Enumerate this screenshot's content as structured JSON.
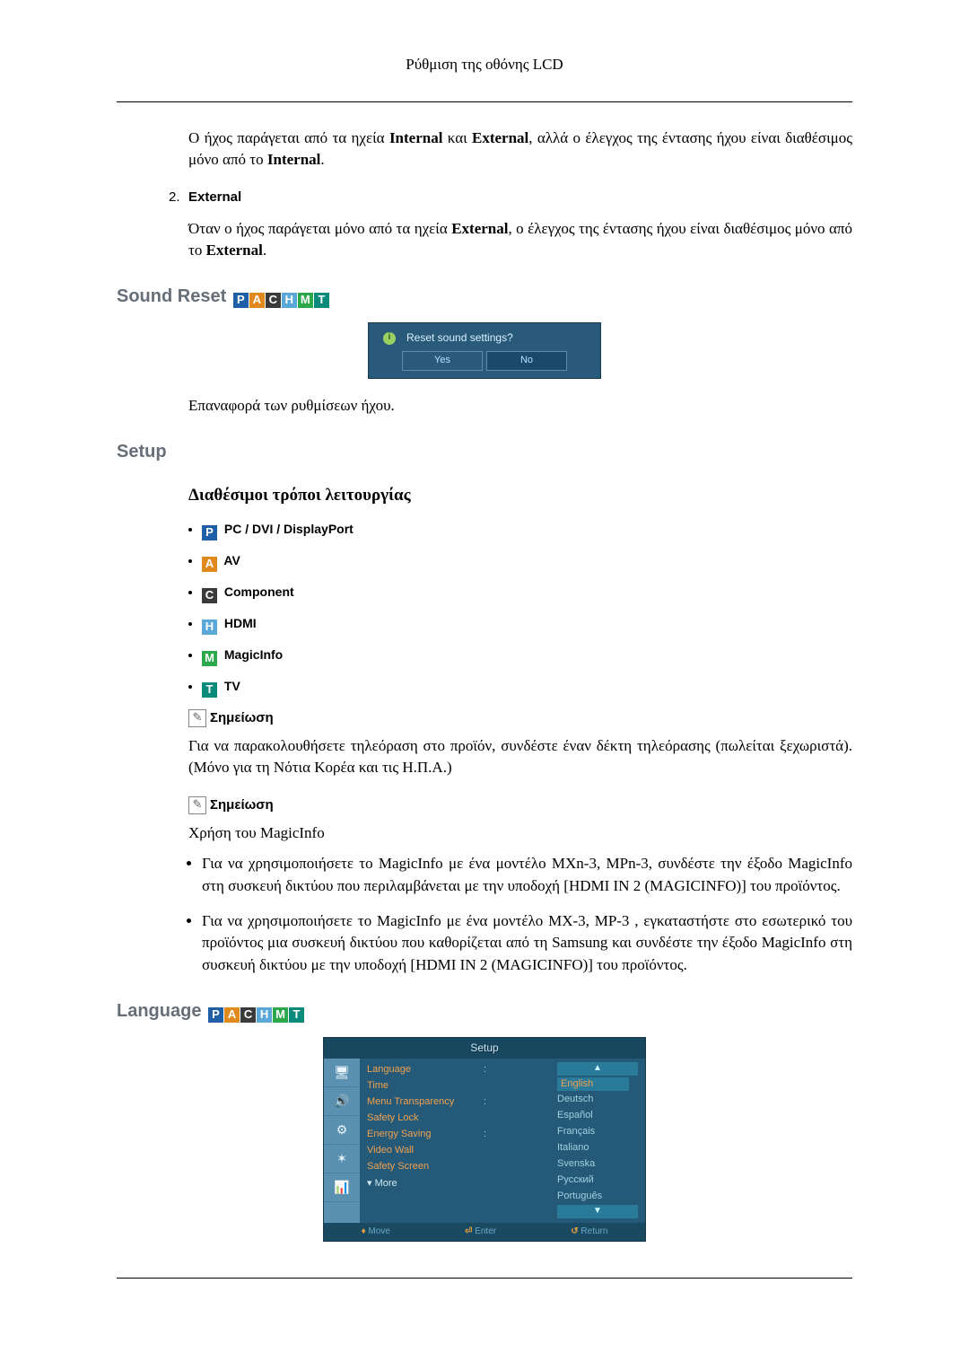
{
  "header": {
    "title": "Ρύθμιση της οθόνης LCD"
  },
  "intro": {
    "p1_a": "Ο ήχος παράγεται από τα ηχεία ",
    "p1_b": " και ",
    "p1_c": ", αλλά ο έλεγχος της έντασης ήχου είναι διαθέσιμος μόνο από το ",
    "p1_d": ".",
    "internal": "Internal",
    "external": "External"
  },
  "item2": {
    "num": "2.",
    "label": "External",
    "p_a": "Όταν ο ήχος παράγεται μόνο από τα ηχεία ",
    "p_b": ", ο έλεγχος της έντασης ήχου είναι διαθέσιμος μόνο από το ",
    "p_c": "."
  },
  "soundReset": {
    "heading": "Sound Reset",
    "dialog": {
      "q": "Reset sound settings?",
      "yes": "Yes",
      "no": "No"
    },
    "desc": "Επαναφορά των ρυθμίσεων ήχου."
  },
  "setup": {
    "heading": "Setup",
    "sub": "Διαθέσιμοι τρόποι λειτουργίας",
    "modes": {
      "p": "PC / DVI / DisplayPort",
      "a": "AV",
      "c": "Component",
      "h": "HDMI",
      "m": "MagicInfo",
      "t": "TV"
    },
    "noteLabel": "Σημείωση",
    "note1": "Για να παρακολουθήσετε τηλεόραση στο προϊόν, συνδέστε έναν δέκτη τηλεόρασης (πωλείται ξεχωριστά). (Μόνο για τη Νότια Κορέα και τις Η.Π.Α.)",
    "note2Intro": "Χρήση του MagicInfo",
    "note2b1": "Για να χρησιμοποιήσετε το MagicInfo με ένα μοντέλο MXn-3, MPn-3, συνδέστε την έξοδο MagicInfo στη συσκευή δικτύου που περιλαμβάνεται με την υποδοχή [HDMI IN 2 (MAGICINFO)] του προϊόντος.",
    "note2b2": "Για να χρησιμοποιήσετε το MagicInfo με ένα μοντέλο MX-3, MP-3 , εγκαταστήστε στο εσωτερικό του προϊόντος μια συσκευή δικτύου που καθορίζεται από τη Samsung και συνδέστε την έξοδο MagicInfo στη συσκευή δικτύου με την υποδοχή [HDMI IN 2 (MAGICINFO)] του προϊόντος."
  },
  "language": {
    "heading": "Language",
    "fig": {
      "title": "Setup",
      "menu": [
        "Language",
        "Time",
        "Menu Transparency",
        "Safety Lock",
        "Energy Saving",
        "Video Wall",
        "Safety Screen"
      ],
      "more": "▾ More",
      "langs": [
        "English",
        "Deutsch",
        "Español",
        "Français",
        "Italiano",
        "Svenska",
        "Русский",
        "Português"
      ],
      "footer": {
        "move": "Move",
        "enter": "Enter",
        "return": "Return"
      }
    }
  }
}
